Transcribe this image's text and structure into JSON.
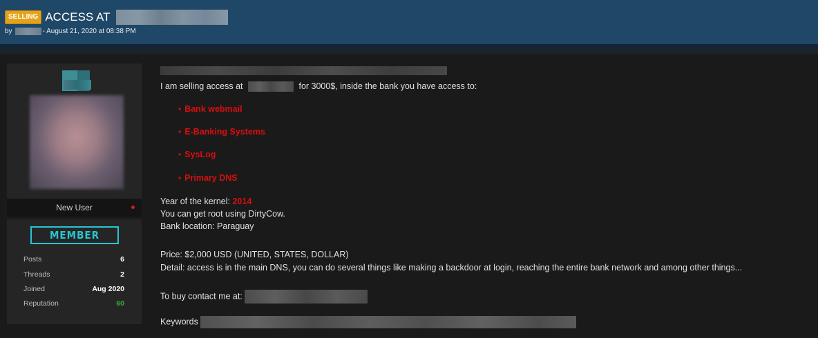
{
  "thread": {
    "prefix": "SELLING",
    "title": "ACCESS AT",
    "by_label": "by",
    "date": "- August 21, 2020 at 08:38 PM"
  },
  "user": {
    "rank": "New User",
    "badge": "MEMBER",
    "stats": [
      {
        "label": "Posts",
        "value": "6"
      },
      {
        "label": "Threads",
        "value": "2"
      },
      {
        "label": "Joined",
        "value": "Aug 2020"
      },
      {
        "label": "Reputation",
        "value": "60"
      }
    ],
    "reputation_color": "#3aab2e"
  },
  "post": {
    "intro_before": "I am selling access at",
    "intro_after": "for 3000$, inside the bank you have access to:",
    "bullets": [
      "Bank webmail",
      "E-Banking Systems",
      "SysLog",
      "Primary DNS"
    ],
    "kernel_label": "Year of the kernel:",
    "kernel_year": "2014",
    "root_line": "You can get root using DirtyCow.",
    "location_line": "Bank location: Paraguay",
    "price_line": "Price: $2,000 USD (UNITED, STATES, DOLLAR)",
    "detail_line": "Detail: access is in the main DNS, you can do several things like making a backdoor at login, reaching the entire bank network and among other things...",
    "contact_label": "To buy contact me at:",
    "keywords_label": "Keywords"
  },
  "colors": {
    "header": "#1f4767",
    "accent_red": "#d80e0e",
    "badge_cyan": "#28c5d3",
    "prefix_orange": "#e3a319"
  }
}
